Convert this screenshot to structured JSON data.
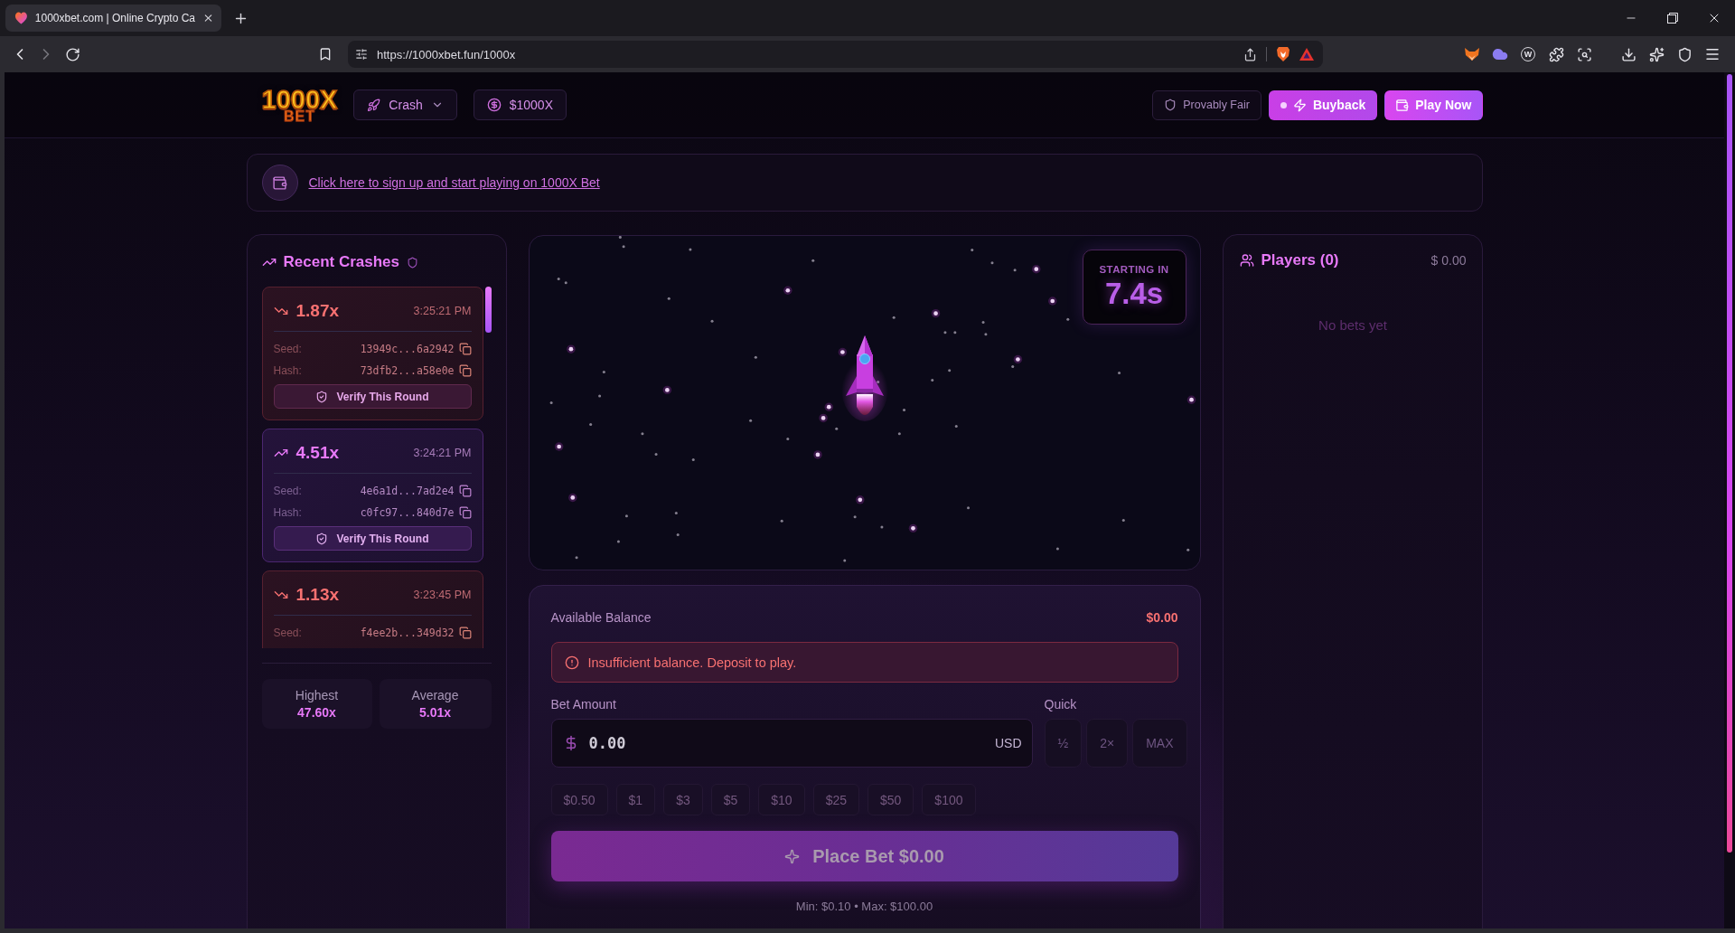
{
  "browser": {
    "tab_title": "1000xbet.com | Online Crypto Ca",
    "url": "https://1000xbet.fun/1000x",
    "extension_badge": "W"
  },
  "header": {
    "logo": {
      "top": "1000X",
      "bottom": "BET"
    },
    "game_menu": "Crash",
    "token_button": "$1000X",
    "actions": [
      {
        "label": "Provably Fair",
        "kind": "outline"
      },
      {
        "label": "Buyback",
        "kind": "buyback"
      },
      {
        "label": "Play Now",
        "kind": "primary"
      }
    ]
  },
  "banner": {
    "link": "Click here to sign up and start playing on 1000X Bet"
  },
  "recent_crashes": {
    "title": "Recent Crashes",
    "rounds": [
      {
        "multiplier": "1.87x",
        "time": "3:25:21 PM",
        "kind": "down",
        "rows": [
          {
            "label": "Seed:",
            "value": "13949c...6a2942"
          },
          {
            "label": "Hash:",
            "value": "73dfb2...a58e0e"
          }
        ],
        "verify": "Verify This Round"
      },
      {
        "multiplier": "4.51x",
        "time": "3:24:21 PM",
        "kind": "up",
        "rows": [
          {
            "label": "Seed:",
            "value": "4e6a1d...7ad2e4"
          },
          {
            "label": "Hash:",
            "value": "c0fc97...840d7e"
          }
        ],
        "verify": "Verify This Round"
      },
      {
        "multiplier": "1.13x",
        "time": "3:23:45 PM",
        "kind": "down",
        "rows": [
          {
            "label": "Seed:",
            "value": "f4ee2b...349d32"
          }
        ]
      }
    ],
    "stats": [
      {
        "label": "Highest",
        "value": "47.60x"
      },
      {
        "label": "Average",
        "value": "5.01x"
      }
    ]
  },
  "game": {
    "countdown_label": "STARTING IN",
    "countdown": "7.4s"
  },
  "bet_panel": {
    "balance_label": "Available Balance",
    "balance": "$0.00",
    "alert": "Insufficient balance. Deposit to play.",
    "amount_label": "Bet Amount",
    "amount": "0.00",
    "currency": "USD",
    "quick_label": "Quick",
    "quick_buttons": [
      {
        "label": "½",
        "disabled": true
      },
      {
        "label": "2×",
        "disabled": true
      },
      {
        "label": "MAX",
        "disabled": true
      }
    ],
    "presets": [
      {
        "label": "$0.50",
        "disabled": true
      },
      {
        "label": "$1",
        "disabled": true
      },
      {
        "label": "$3",
        "disabled": true
      },
      {
        "label": "$5",
        "disabled": true
      },
      {
        "label": "$10",
        "disabled": true
      },
      {
        "label": "$25",
        "disabled": true
      },
      {
        "label": "$50",
        "disabled": true
      },
      {
        "label": "$100",
        "disabled": true
      }
    ],
    "place_bet": {
      "label": "Place Bet $0.00",
      "disabled": true
    },
    "limits": "Min: $0.10 • Max: $100.00"
  },
  "players": {
    "title": "Players (0)",
    "total": "$ 0.00",
    "empty_message": "No bets yet"
  }
}
